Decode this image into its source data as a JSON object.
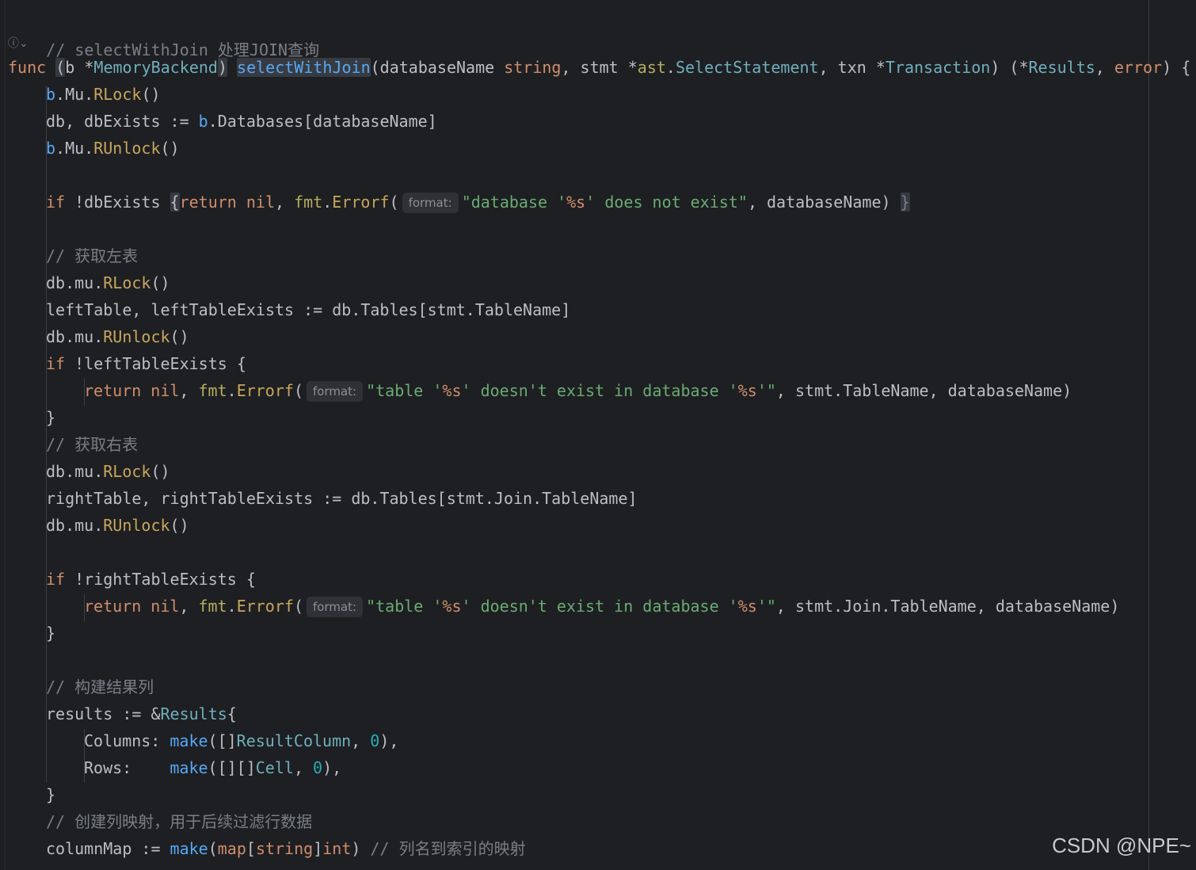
{
  "colors": {
    "background": "#1e1f22",
    "default_text": "#bcbec4",
    "keyword": "#cf8e6d",
    "function": "#56a8f5",
    "type": "#6fafbd",
    "string": "#6aab73",
    "comment": "#7a7e85",
    "number": "#2aacb8",
    "method": "#c7a65d"
  },
  "gutter": {
    "widget_icon": "ai-assist-icon",
    "widget_glyph": "ⓘ⌄"
  },
  "hint_label": "format:",
  "code": {
    "l1_comment": "// selectWithJoin 处理JOIN查询",
    "l2": {
      "func": "func",
      "recv_open": "(",
      "recv_name": "b ",
      "recv_star": "*",
      "recv_type": "MemoryBackend",
      "recv_close": ")",
      "fn_name": "selectWithJoin",
      "p1": "(databaseName ",
      "string_kw": "string",
      "p2": ", stmt *",
      "pkg": "ast",
      "dot": ".",
      "sel_type": "SelectStatement",
      "p3": ", txn *",
      "tx_type": "Transaction",
      "p4": ") (*",
      "res_type": "Results",
      "comma": ", ",
      "error_kw": "error",
      "p5": ") {"
    },
    "l3": {
      "b": "b",
      "a": ".Mu.",
      "m": "RLock",
      "z": "()"
    },
    "l4": {
      "a": "db, dbExists := ",
      "b": "b",
      "c": ".Databases[databaseName]"
    },
    "l5": {
      "b": "b",
      "a": ".Mu.",
      "m": "RUnlock",
      "z": "()"
    },
    "l6": {
      "if_kw": "if",
      "a": " !dbExists ",
      "brace_open": "{",
      "return_kw": "return",
      "nil_kw": " nil",
      "comma": ", ",
      "fmt": "fmt",
      "dot": ".",
      "errorf": "Errorf",
      "paren": "(",
      "str_a": "\"database '",
      "ph": "%s",
      "str_b": "' does not exist\"",
      "rest": ", databaseName) ",
      "brace_close": "}"
    },
    "l7_comment": "// 获取左表",
    "l8": {
      "a": "db.mu.",
      "m": "RLock",
      "z": "()"
    },
    "l9": "leftTable, leftTableExists := db.Tables[stmt.TableName]",
    "l10": {
      "a": "db.mu.",
      "m": "RUnlock",
      "z": "()"
    },
    "l11": {
      "if_kw": "if",
      "a": " !leftTableExists {"
    },
    "l12": {
      "return_kw": "return",
      "nil_kw": " nil",
      "comma": ", ",
      "fmt": "fmt",
      "dot": ".",
      "errorf": "Errorf",
      "paren": "(",
      "str_a": "\"table '",
      "ph1": "%s",
      "str_b": "' doesn't exist in database '",
      "ph2": "%s",
      "str_c": "'\"",
      "rest": ", stmt.TableName, databaseName)"
    },
    "l13": "}",
    "l14_comment": "// 获取右表",
    "l15": {
      "a": "db.mu.",
      "m": "RLock",
      "z": "()"
    },
    "l16": "rightTable, rightTableExists := db.Tables[stmt.Join.TableName]",
    "l17": {
      "a": "db.mu.",
      "m": "RUnlock",
      "z": "()"
    },
    "l18": {
      "if_kw": "if",
      "a": " !rightTableExists {"
    },
    "l19": {
      "return_kw": "return",
      "nil_kw": " nil",
      "comma": ", ",
      "fmt": "fmt",
      "dot": ".",
      "errorf": "Errorf",
      "paren": "(",
      "str_a": "\"table '",
      "ph1": "%s",
      "str_b": "' doesn't exist in database '",
      "ph2": "%s",
      "str_c": "'\"",
      "rest": ", stmt.Join.TableName, databaseName)"
    },
    "l20": "}",
    "l21_comment": "// 构建结果列",
    "l22": {
      "a": "results := &",
      "t": "Results",
      "z": "{"
    },
    "l23": {
      "a": "Columns: ",
      "make": "make",
      "b": "([]",
      "t": "ResultColumn",
      "c": ", ",
      "n": "0",
      "d": "),"
    },
    "l24": {
      "a": "Rows:    ",
      "make": "make",
      "b": "([][]",
      "t": "Cell",
      "c": ", ",
      "n": "0",
      "d": "),"
    },
    "l25": "}",
    "l26_comment": "// 创建列映射，用于后续过滤行数据",
    "l27": {
      "a": "columnMap := ",
      "make": "make",
      "b": "(",
      "map_kw": "map",
      "c": "[",
      "string_kw": "string",
      "d": "]",
      "int_kw": "int",
      "e": ") ",
      "comment": "// 列名到索引的映射"
    }
  },
  "watermark": "CSDN @NPE~"
}
